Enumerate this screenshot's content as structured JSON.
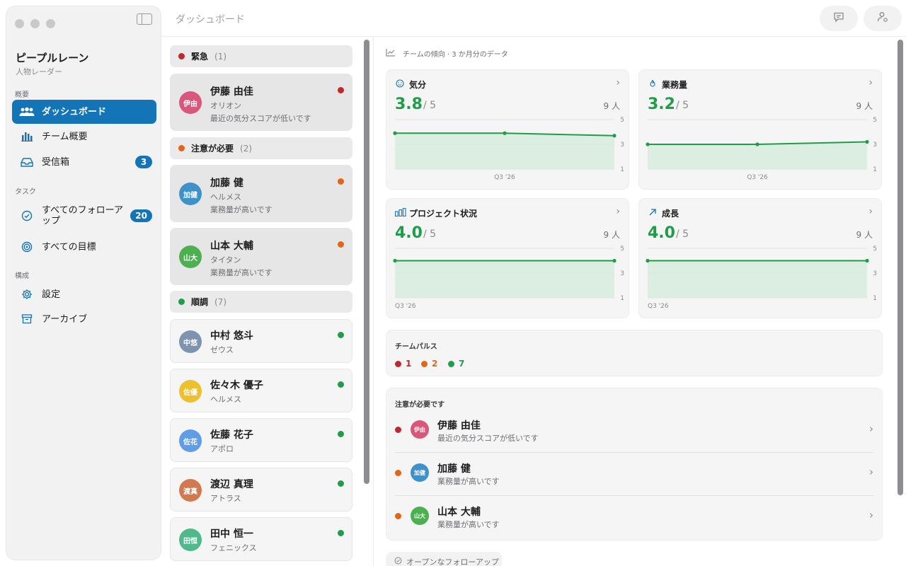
{
  "app": {
    "title": "ピープルレーン",
    "subtitle": "人物レーダー"
  },
  "sidebar": {
    "sections": [
      "概要",
      "タスク",
      "構成"
    ],
    "items": [
      {
        "label": "ダッシュボード",
        "icon": "people-icon",
        "active": true
      },
      {
        "label": "チーム概要",
        "icon": "bar-chart-icon"
      },
      {
        "label": "受信箱",
        "icon": "inbox-icon",
        "badge": "3"
      },
      {
        "label": "すべてのフォローアップ",
        "icon": "check-circle-icon",
        "badge": "20"
      },
      {
        "label": "すべての目標",
        "icon": "target-icon"
      },
      {
        "label": "設定",
        "icon": "gear-icon"
      },
      {
        "label": "アーカイブ",
        "icon": "archive-icon"
      }
    ]
  },
  "topbar": {
    "title": "ダッシュボード",
    "buttons": [
      "chat-icon",
      "person-settings-icon"
    ]
  },
  "colors": {
    "accent": "#1474b8",
    "red": "#c0282e",
    "orange": "#e2651a",
    "green": "#1f9d48"
  },
  "groups": [
    {
      "label": "緊急",
      "count": "(1)",
      "color": "#c0282e"
    },
    {
      "label": "注意が必要",
      "count": "(2)",
      "color": "#e2651a"
    },
    {
      "label": "順調",
      "count": "(7)",
      "color": "#1f9d48"
    }
  ],
  "people": [
    {
      "name": "伊藤 由佳",
      "initials": "伊由",
      "team": "オリオン",
      "reason": "最近の気分スコアが低いです",
      "status": "#c0282e",
      "avatar": "#d9577a"
    },
    {
      "name": "加藤 健",
      "initials": "加健",
      "team": "ヘルメス",
      "reason": "業務量が高いです",
      "status": "#e2651a",
      "avatar": "#3d92c9"
    },
    {
      "name": "山本 大輔",
      "initials": "山大",
      "team": "タイタン",
      "reason": "業務量が高いです",
      "status": "#e2651a",
      "avatar": "#4caf50"
    },
    {
      "name": "中村 悠斗",
      "initials": "中悠",
      "team": "ゼウス",
      "status": "#1f9d48",
      "avatar": "#7e93ad"
    },
    {
      "name": "佐々木 優子",
      "initials": "佐優",
      "team": "ヘルメス",
      "status": "#1f9d48",
      "avatar": "#ecc02e"
    },
    {
      "name": "佐藤 花子",
      "initials": "佐花",
      "team": "アポロ",
      "status": "#1f9d48",
      "avatar": "#5f9de8"
    },
    {
      "name": "渡辺 真理",
      "initials": "渡真",
      "team": "アトラス",
      "status": "#1f9d48",
      "avatar": "#d27a4e"
    },
    {
      "name": "田中 恒一",
      "initials": "田恒",
      "team": "フェニックス",
      "status": "#1f9d48",
      "avatar": "#4fb98c"
    }
  ],
  "dashboard": {
    "trend_caption": "チームの傾向 · 3 か月分のデータ",
    "metrics": [
      {
        "title": "気分",
        "icon": "smile-icon",
        "value": "3.8",
        "scale": "/ 5",
        "people": "9 人",
        "period": "Q3 '26"
      },
      {
        "title": "業務量",
        "icon": "flame-icon",
        "value": "3.2",
        "scale": "/ 5",
        "people": "9 人",
        "period": "Q3 '26"
      },
      {
        "title": "プロジェクト状況",
        "icon": "bars-icon",
        "value": "4.0",
        "scale": "/ 5",
        "people": "9 人",
        "period": "Q3 '26"
      },
      {
        "title": "成長",
        "icon": "arrow-up-right-icon",
        "value": "4.0",
        "scale": "/ 5",
        "people": "9 人",
        "period": "Q3 '26"
      }
    ],
    "pulse": {
      "title": "チームパルス",
      "items": [
        {
          "value": "1",
          "color": "#c0282e"
        },
        {
          "value": "2",
          "color": "#e2651a"
        },
        {
          "value": "7",
          "color": "#1f9d48"
        }
      ]
    },
    "attention": {
      "title": "注意が必要です",
      "rows": [
        {
          "name": "伊藤 由佳",
          "initials": "伊由",
          "reason": "最近の気分スコアが低いです",
          "status": "#c0282e",
          "avatar": "#d9577a"
        },
        {
          "name": "加藤 健",
          "initials": "加健",
          "reason": "業務量が高いです",
          "status": "#e2651a",
          "avatar": "#3d92c9"
        },
        {
          "name": "山本 大輔",
          "initials": "山大",
          "reason": "業務量が高いです",
          "status": "#e2651a",
          "avatar": "#4caf50"
        }
      ]
    },
    "open_followups": "オープンなフォローアップ"
  },
  "chart_data": [
    {
      "type": "area",
      "title": "気分",
      "x": [
        "",
        "Q3 '26",
        ""
      ],
      "values": [
        3.9,
        3.9,
        3.7
      ],
      "ylim": [
        1,
        5
      ],
      "yticks": [
        "5",
        "3",
        "1"
      ]
    },
    {
      "type": "area",
      "title": "業務量",
      "x": [
        "",
        "Q3 '26",
        ""
      ],
      "values": [
        3.0,
        3.0,
        3.2
      ],
      "ylim": [
        1,
        5
      ],
      "yticks": [
        "5",
        "3",
        "1"
      ]
    },
    {
      "type": "area",
      "title": "プロジェクト状況",
      "x": [
        "Q3 '26",
        ""
      ],
      "values": [
        4.0,
        4.0
      ],
      "ylim": [
        1,
        5
      ],
      "yticks": [
        "5",
        "3",
        "1"
      ]
    },
    {
      "type": "area",
      "title": "成長",
      "x": [
        "Q3 '26",
        ""
      ],
      "values": [
        4.0,
        4.0
      ],
      "ylim": [
        1,
        5
      ],
      "yticks": [
        "5",
        "3",
        "1"
      ]
    }
  ]
}
